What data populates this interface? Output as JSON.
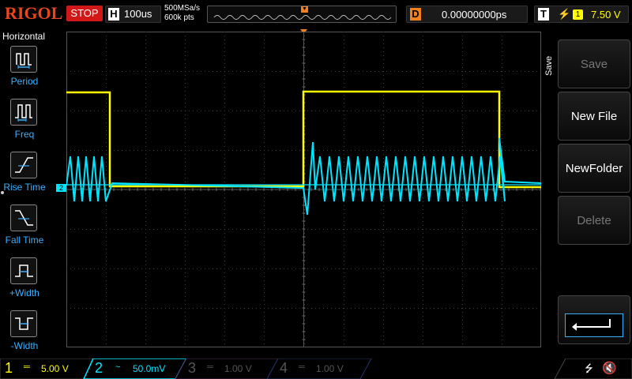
{
  "header": {
    "brand": "RIGOL",
    "run_state": "STOP",
    "horizontal_letter": "H",
    "timebase": "100us",
    "sample_rate": "500MSa/s",
    "memory_depth": "600k pts",
    "delay_letter": "D",
    "delay_value": "0.00000000ps",
    "trigger_letter": "T",
    "trigger_edge": "⚡",
    "trigger_source": "1",
    "trigger_level": "7.50 V"
  },
  "left_menu": {
    "title": "Horizontal",
    "items": [
      {
        "label": "Period",
        "icon": "period-icon"
      },
      {
        "label": "Freq",
        "icon": "frequency-icon"
      },
      {
        "label": "Rise Time",
        "icon": "rise-time-icon"
      },
      {
        "label": "Fall Time",
        "icon": "fall-time-icon"
      },
      {
        "label": "+Width",
        "icon": "positive-width-icon"
      },
      {
        "label": "-Width",
        "icon": "negative-width-icon"
      }
    ]
  },
  "right_menu": {
    "title": "Save",
    "buttons": [
      {
        "label": "Save",
        "enabled": false
      },
      {
        "label": "New File",
        "enabled": true
      },
      {
        "label": "NewFolder",
        "enabled": true
      },
      {
        "label": "Delete",
        "enabled": false
      }
    ],
    "enter_icon": "enter-icon"
  },
  "markers": {
    "ch2_label": "2",
    "trigger_level_marker": "T"
  },
  "channels": [
    {
      "num": "1",
      "coupling": "═",
      "scale": "5.00 V",
      "color": "#ffff00",
      "active": true
    },
    {
      "num": "2",
      "coupling": "~",
      "scale": "50.0mV",
      "color": "#00e5ff",
      "active": true
    },
    {
      "num": "3",
      "coupling": "═",
      "scale": "1.00 V",
      "color": "#ff40ff",
      "active": false
    },
    {
      "num": "4",
      "coupling": "═",
      "scale": "1.00 V",
      "color": "#3a7aff",
      "active": false
    }
  ],
  "status_icons": [
    "usb-icon",
    "speaker-muted-icon"
  ],
  "colors": {
    "ch1": "#ffff00",
    "ch2": "#00e5ff",
    "grid": "#404040",
    "trigger": "#f08020",
    "stop": "#d01818",
    "menu_label": "#3ab0ff"
  }
}
